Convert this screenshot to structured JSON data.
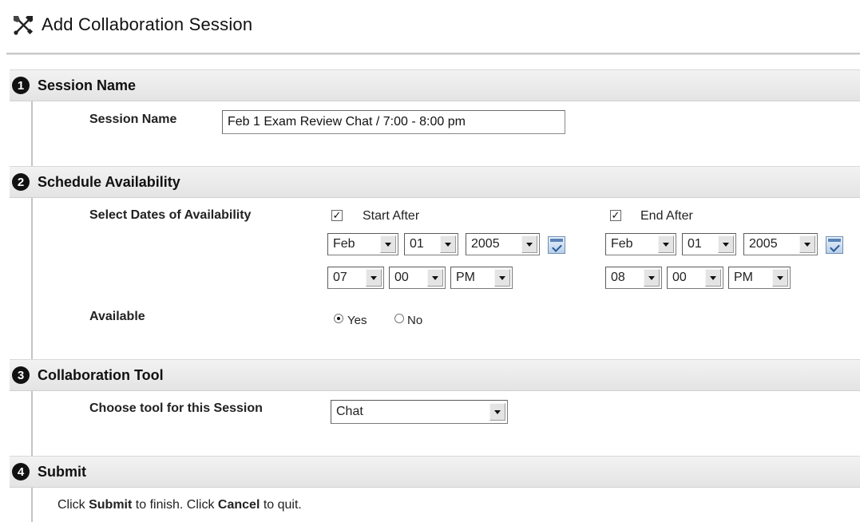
{
  "page": {
    "title": "Add Collaboration Session",
    "title_icon": "tools-icon"
  },
  "sections": {
    "s1": {
      "number": "1",
      "title": "Session Name"
    },
    "s2": {
      "number": "2",
      "title": "Schedule Availability"
    },
    "s3": {
      "number": "3",
      "title": "Collaboration Tool"
    },
    "s4": {
      "number": "4",
      "title": "Submit"
    }
  },
  "session_name": {
    "label": "Session Name",
    "value": "Feb 1 Exam Review Chat / 7:00 - 8:00 pm"
  },
  "availability": {
    "dates_label": "Select Dates of Availability",
    "start": {
      "checked": true,
      "label": "Start After",
      "month": "Feb",
      "day": "01",
      "year": "2005",
      "hour": "07",
      "minute": "00",
      "ampm": "PM"
    },
    "end": {
      "checked": true,
      "label": "End After",
      "month": "Feb",
      "day": "01",
      "year": "2005",
      "hour": "08",
      "minute": "00",
      "ampm": "PM"
    },
    "available_label": "Available",
    "options": {
      "yes": "Yes",
      "no": "No"
    },
    "selected": "yes"
  },
  "tool": {
    "label": "Choose tool for this Session",
    "value": "Chat"
  },
  "submit": {
    "text_1": "Click ",
    "submit_word": "Submit",
    "text_2": " to finish. Click ",
    "cancel_word": "Cancel",
    "text_3": " to quit."
  }
}
